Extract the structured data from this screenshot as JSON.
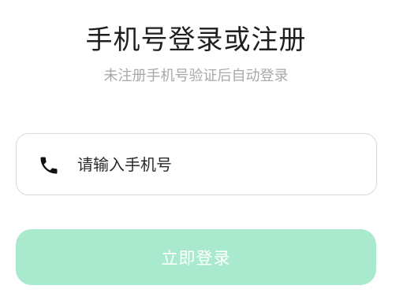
{
  "header": {
    "title": "手机号登录或注册",
    "subtitle": "未注册手机号验证后自动登录"
  },
  "phone_field": {
    "icon": "phone-icon",
    "value": "",
    "placeholder": "请输入手机号"
  },
  "login_button": {
    "label": "立即登录",
    "background": "#a9e9cd",
    "text_color": "#ffffff"
  }
}
